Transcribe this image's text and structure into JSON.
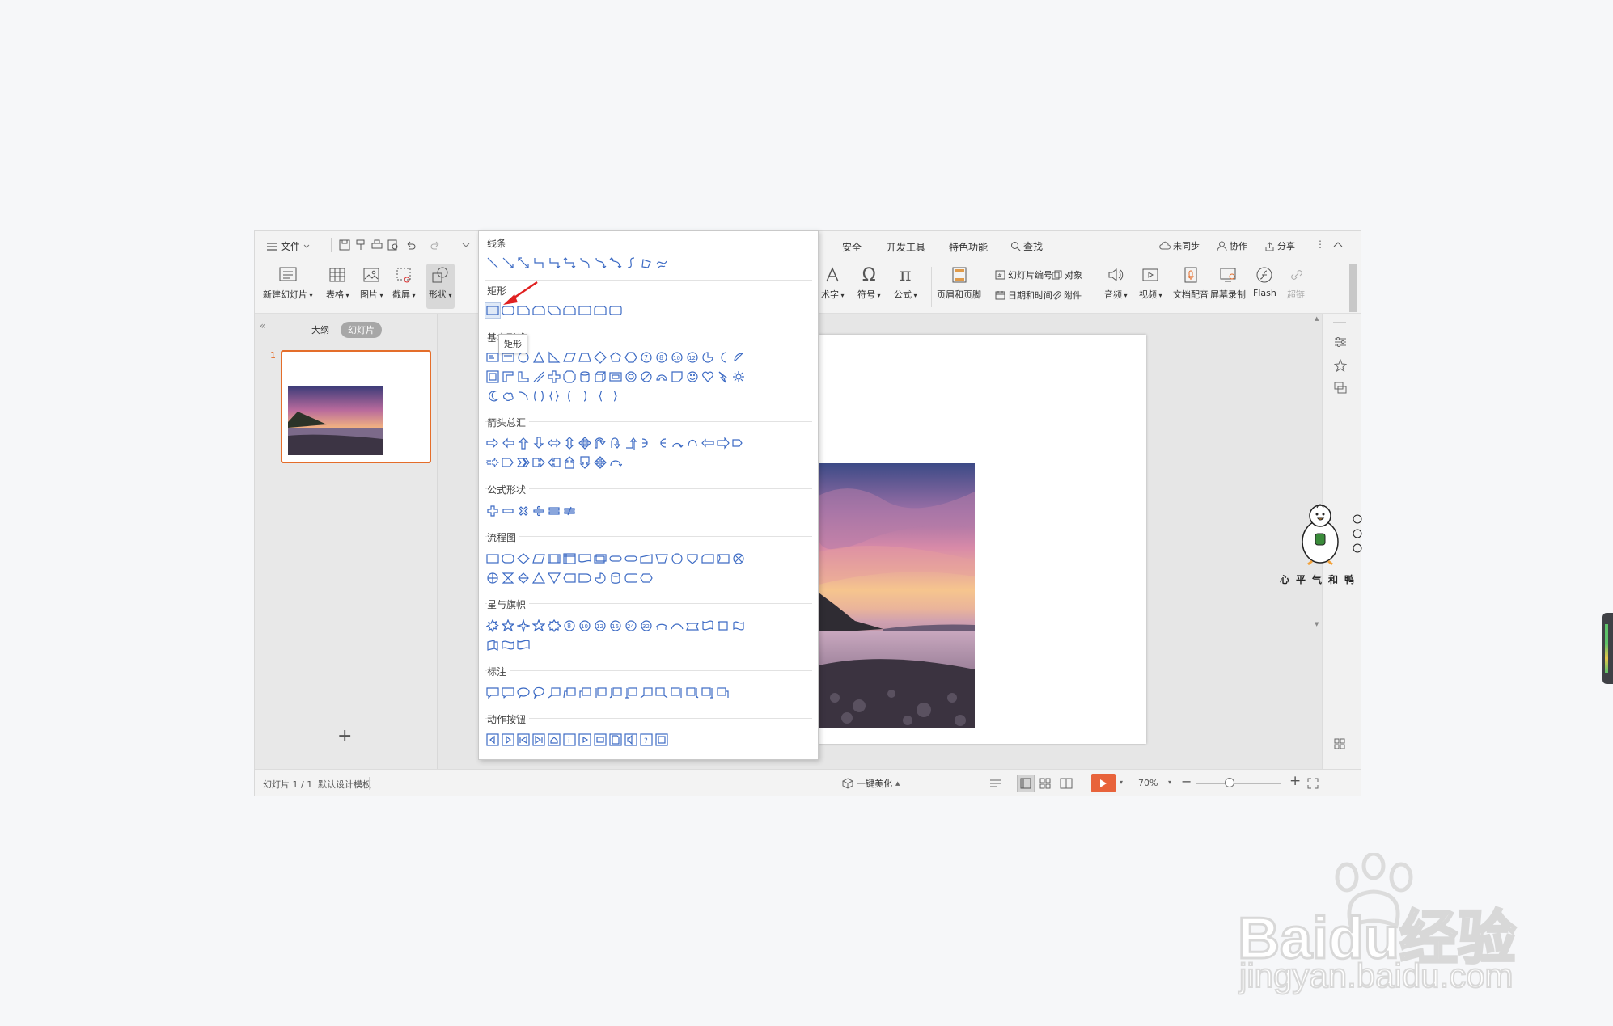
{
  "menubar": {
    "file": "文件",
    "tabs": [
      "安全",
      "开发工具",
      "特色功能"
    ],
    "search": "查找",
    "sync": "未同步",
    "collab": "协作",
    "share": "分享"
  },
  "ribbon": {
    "new_slide": "新建幻灯片",
    "table": "表格",
    "image": "图片",
    "screenshot": "截屏",
    "shapes": "形状",
    "art_text": "术字",
    "symbol": "符号",
    "formula": "公式",
    "header_footer": "页眉和页脚",
    "slide_number": "幻灯片编号",
    "object": "对象",
    "datetime": "日期和时间",
    "attachment": "附件",
    "audio": "音频",
    "video": "视频",
    "doc_dub": "文档配音",
    "screen_record": "屏幕录制",
    "flash": "Flash",
    "hyperlink": "超链"
  },
  "left_panel": {
    "tab_outline": "大纲",
    "tab_slides": "幻灯片",
    "slide_number": "1"
  },
  "statusbar": {
    "slide_info": "幻灯片 1 / 1",
    "template": "默认设计模板",
    "beautify": "一键美化",
    "zoom": "70%",
    "zoom_level": 0.7
  },
  "shape_panel": {
    "sections": [
      "线条",
      "矩形",
      "基本形状",
      "箭头总汇",
      "公式形状",
      "流程图",
      "星与旗帜",
      "标注",
      "动作按钮"
    ],
    "tooltip": "矩形",
    "selected": "矩形"
  },
  "mascot_caption": "心平气和鸭",
  "watermark": {
    "brand": "Baidu经验",
    "url": "jingyan.baidu.com"
  },
  "colors": {
    "accent": "#e46d2a",
    "shape_stroke": "#3d6bc4",
    "play": "#e8633b"
  }
}
